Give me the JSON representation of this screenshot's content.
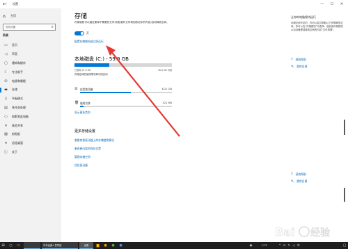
{
  "window": {
    "title": "设置",
    "back": "←",
    "minimize": "—",
    "maximize": "☐",
    "close": "✕"
  },
  "sidebar": {
    "home_label": "主页",
    "search_placeholder": "查找设置",
    "section_title": "系统",
    "items": [
      {
        "label": "显示",
        "icon": "display-icon",
        "glyph": "▭"
      },
      {
        "label": "声音",
        "icon": "speaker-icon",
        "glyph": "◁"
      },
      {
        "label": "通知和操作",
        "icon": "notification-icon",
        "glyph": "▢"
      },
      {
        "label": "专注助手",
        "icon": "moon-icon",
        "glyph": "☾"
      },
      {
        "label": "电源和睡眠",
        "icon": "power-icon",
        "glyph": "⏻"
      },
      {
        "label": "存储",
        "icon": "storage-icon",
        "glyph": "▬",
        "active": true
      },
      {
        "label": "平板模式",
        "icon": "tablet-icon",
        "glyph": "▯"
      },
      {
        "label": "多任务处理",
        "icon": "multitask-icon",
        "glyph": "▤"
      },
      {
        "label": "投影到此电脑",
        "icon": "project-icon",
        "glyph": "▭"
      },
      {
        "label": "体验共享",
        "icon": "share-icon",
        "glyph": "✕"
      },
      {
        "label": "剪贴板",
        "icon": "clipboard-icon",
        "glyph": "▨"
      },
      {
        "label": "远程桌面",
        "icon": "remote-icon",
        "glyph": "✕"
      },
      {
        "label": "关于",
        "icon": "info-icon",
        "glyph": "ⓘ"
      }
    ]
  },
  "main": {
    "title": "存储",
    "description": "存储感知可以通过删除不需要的文件(例如临时文件和回收站中的内容)自动释放空间。",
    "toggle_state": "开",
    "toggle_on": true,
    "config_link": "配置存储感知或立即运行",
    "disk": {
      "title": "本地磁盘 (C:) - 59.9 GB",
      "used_label": "已使用 21.5 GB",
      "free_label": "38.4 GB 可用",
      "used_fraction": 0.36,
      "note": "存储空间的使用情况和可用空间"
    },
    "categories": [
      {
        "name": "应用和功能",
        "size": "6.21 GB",
        "fraction": 0.55,
        "icon": "apps-icon",
        "glyph": "☰"
      },
      {
        "name": "临时文件",
        "size": "321 MB",
        "fraction": 0.04,
        "icon": "trash-icon",
        "glyph": "🗑"
      }
    ],
    "more_categories": "显示更多类别",
    "more_settings_title": "更多存储设置",
    "more_links": [
      "查看其他驱动器上的存储使用情况",
      "更改新内容的保存位置",
      "管理存储空间",
      "优化驱动器"
    ]
  },
  "right": {
    "heading": "让你的电脑保持运行",
    "description": "存储空间不足时，你可以尝试采取以下步骤释放空间，你可以在“存储感知”中选择，或启用存储感知以自动管理或释放空间的内容“文件清理”。",
    "links": [
      "获取帮助",
      "提供反馈"
    ],
    "help_links": [
      "获取帮助",
      "提供反馈"
    ]
  },
  "taskbar": {
    "start": "⊞",
    "search": "○",
    "taskview": "▭",
    "app1": "",
    "app2": "中华经典人员导航",
    "app3": "设置",
    "weather": "11°C",
    "tray": "^ ⊡ ✎ ◁ 中",
    "time": "",
    "colors": {
      "accent": "#0078d7",
      "taskbar": "#1f1f1f",
      "sidebar": "#f2f2f2",
      "annotation": "#e53935"
    }
  }
}
